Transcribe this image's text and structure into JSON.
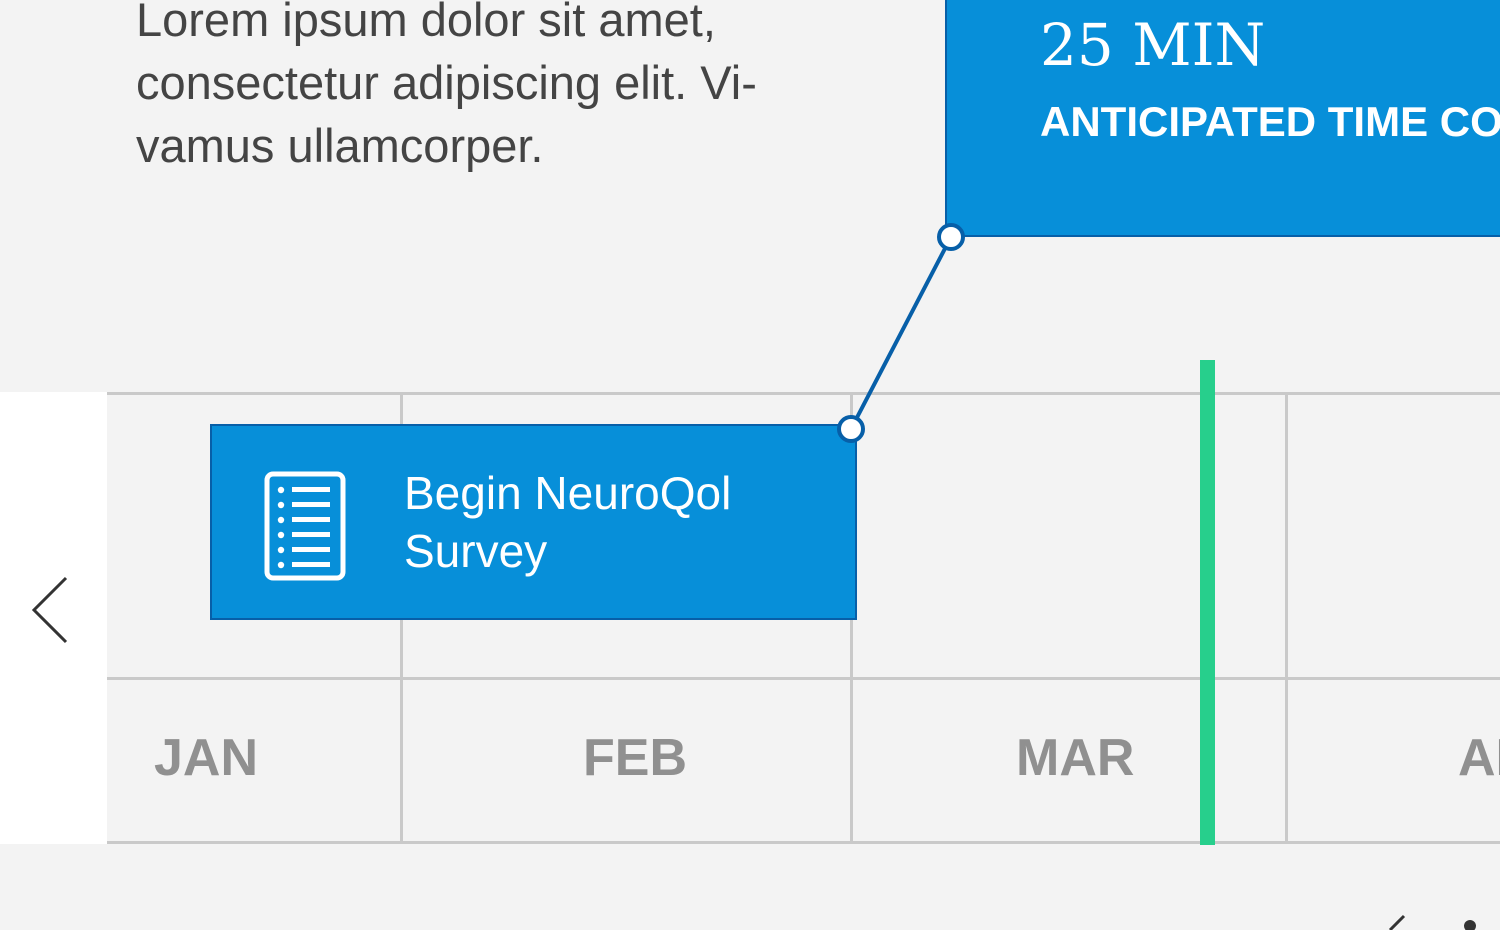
{
  "intro": {
    "text": "Lorem ipsum dolor sit amet,\nconsectetur adipiscing elit. Vi-\nvamus ullamcorper."
  },
  "info_card": {
    "duration": "25 MIN",
    "caption": "ANTICIPATED TIME CO"
  },
  "timeline": {
    "months": [
      "JAN",
      "FEB",
      "MAR",
      "AP"
    ],
    "event": {
      "label": "Begin NeuroQol\nSurvey",
      "icon": "checklist-icon"
    },
    "today_marker_color": "#27cf8c",
    "nav": {
      "prev_icon": "chevron-left-icon"
    }
  },
  "colors": {
    "accent": "#078fd9",
    "accent_border": "#075fa8",
    "background": "#f3f3f3",
    "muted_text": "#909090",
    "body_text": "#444444"
  }
}
